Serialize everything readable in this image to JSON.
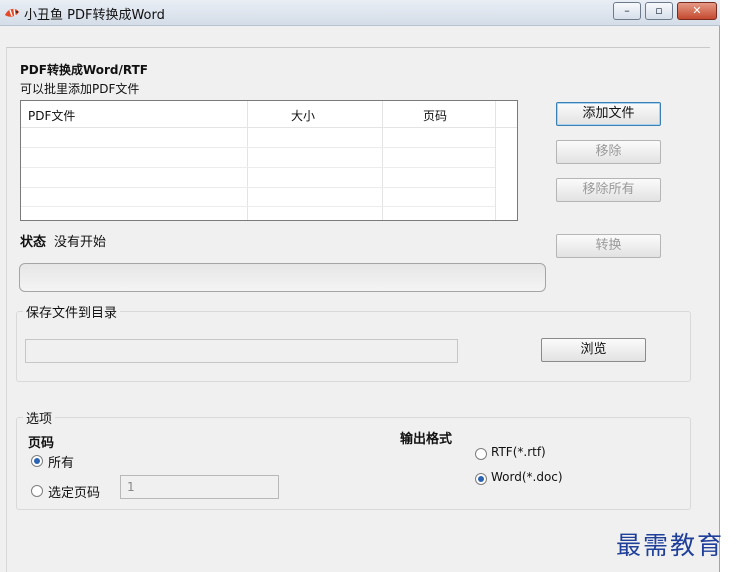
{
  "window": {
    "title": "小丑鱼 PDF转换成Word",
    "minimize_glyph": "–",
    "maximize_glyph": "▫",
    "close_glyph": "✕"
  },
  "header": {
    "heading": "PDF转换成Word/RTF",
    "subheading": "可以批里添加PDF文件"
  },
  "file_table": {
    "columns": [
      "PDF文件",
      "大小",
      "页码"
    ]
  },
  "buttons": {
    "add_file": "添加文件",
    "remove": "移除",
    "remove_all": "移除所有",
    "convert": "转换",
    "browse": "浏览"
  },
  "status": {
    "label": "状态",
    "value": "没有开始"
  },
  "save_group": {
    "title": "保存文件到目录",
    "path_value": ""
  },
  "options_group": {
    "title": "选项",
    "pages_heading": "页码",
    "all_pages": "所有",
    "selected_pages": "选定页码",
    "page_value": "1",
    "output_heading": "输出格式",
    "rtf": "RTF(*.rtf)",
    "word": "Word(*.doc)"
  },
  "watermark": "最需教育",
  "colors": {
    "watermark": "#1f3f9a",
    "radio_checked": "#2b63b4",
    "close_button": "#c4492f"
  }
}
